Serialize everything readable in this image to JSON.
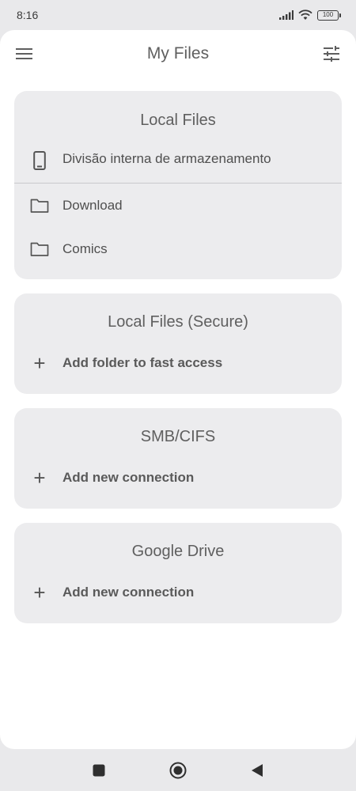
{
  "status_bar": {
    "time": "8:16",
    "battery": "100"
  },
  "app_bar": {
    "title": "My Files"
  },
  "cards": {
    "local": {
      "title": "Local Files",
      "items": [
        {
          "label": "Divisão interna de armazenamento",
          "icon": "phone-icon"
        },
        {
          "label": "Download",
          "icon": "folder-icon"
        },
        {
          "label": "Comics",
          "icon": "folder-icon"
        }
      ]
    },
    "secure": {
      "title": "Local Files (Secure)",
      "action": "Add folder to fast access"
    },
    "smb": {
      "title": "SMB/CIFS",
      "action": "Add new connection"
    },
    "gdrive": {
      "title": "Google Drive",
      "action": "Add new connection"
    }
  },
  "nav": {
    "recents_icon": "square-icon",
    "home_icon": "circle-icon",
    "back_icon": "triangle-back-icon"
  }
}
